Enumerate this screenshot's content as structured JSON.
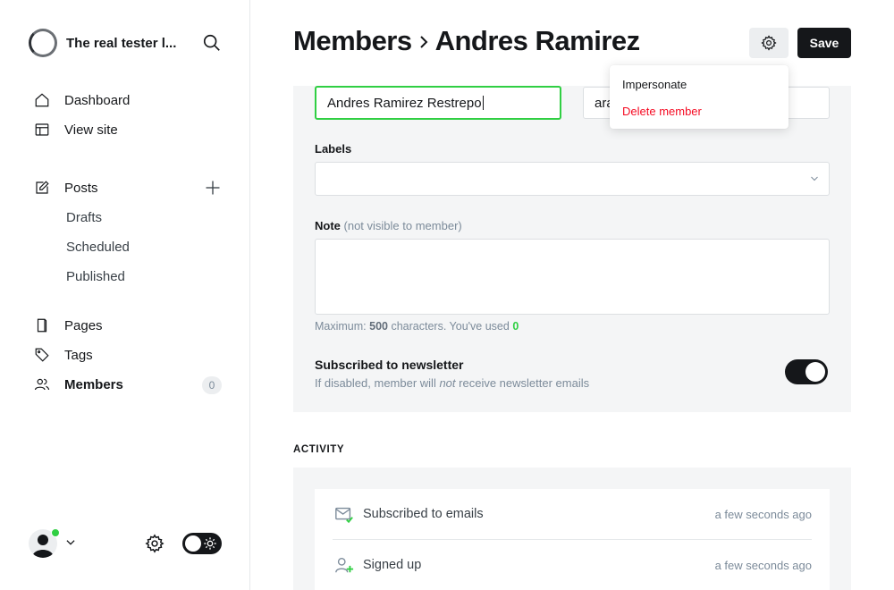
{
  "site": {
    "title": "The real tester l..."
  },
  "sidebar": {
    "items": [
      {
        "label": "Dashboard",
        "icon": "home-icon"
      },
      {
        "label": "View site",
        "icon": "layout-icon"
      },
      {
        "label": "Posts",
        "icon": "edit-icon"
      },
      {
        "label": "Drafts"
      },
      {
        "label": "Scheduled"
      },
      {
        "label": "Published"
      },
      {
        "label": "Pages",
        "icon": "page-icon"
      },
      {
        "label": "Tags",
        "icon": "tag-icon"
      },
      {
        "label": "Members",
        "icon": "members-icon",
        "count": "0"
      }
    ]
  },
  "header": {
    "breadcrumb_parent": "Members",
    "breadcrumb_current": "Andres Ramirez",
    "save_label": "Save"
  },
  "member": {
    "name_value": "Andres Ramirez Restrepo",
    "email_value_visible": "ara",
    "labels_label": "Labels",
    "note_label": "Note",
    "note_sublabel": "(not visible to member)",
    "note_hint_prefix": "Maximum:",
    "note_max": "500",
    "note_hint_middle": "characters. You've used",
    "note_used": "0",
    "newsletter_title": "Subscribed to newsletter",
    "newsletter_desc_before": "If disabled, member will",
    "newsletter_desc_em": "not",
    "newsletter_desc_after": "receive newsletter emails"
  },
  "dropdown": {
    "items": [
      {
        "label": "Impersonate"
      },
      {
        "label": "Delete member"
      }
    ]
  },
  "activity": {
    "heading": "ACTIVITY",
    "rows": [
      {
        "title": "Subscribed to emails",
        "time": "a few seconds ago",
        "icon": "mail-check-icon"
      },
      {
        "title": "Signed up",
        "time": "a few seconds ago",
        "icon": "user-add-icon"
      }
    ]
  },
  "colors": {
    "accent": "#30cf43",
    "danger": "#f50b23",
    "dark": "#15171a"
  }
}
